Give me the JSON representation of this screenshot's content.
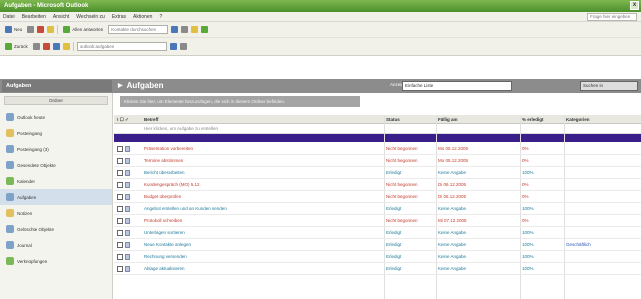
{
  "window": {
    "title": "Aufgaben - Microsoft Outlook",
    "close": "x"
  },
  "menu": [
    "Datei",
    "Bearbeiten",
    "Ansicht",
    "Wechseln zu",
    "Extras",
    "Aktionen",
    "?"
  ],
  "help_placeholder": "Frage hier eingeben",
  "toolbar1": {
    "new": "Neu",
    "reply_all": "Allen antworten",
    "search_placeholder": "Kontakte durchsuchen",
    "address_book": "Adressbuch"
  },
  "toolbar2": {
    "back": "Zurück",
    "address_value": "outlook:aufgaben"
  },
  "nav": {
    "header": "Aufgaben",
    "section": "Ordner",
    "items": [
      "Outlook heute",
      "Posteingang",
      "Posteingang (3)",
      "Gesendete Objekte",
      "Kalender",
      "Aufgaben",
      "Notizen",
      "Gelöschte Objekte",
      "Journal",
      "Verknüpfungen"
    ],
    "active_index": 5
  },
  "main": {
    "title": "Aufgaben",
    "title_chevron": "▾",
    "filter_label": "Anzeige:",
    "filter_value": "Einfache Liste",
    "search_value": "Suchen in",
    "banner": "Klicken Sie hier, um Elemente hinzuzufügen, die sich in diesem Ordner befinden."
  },
  "table": {
    "columns": [
      "Betreff",
      "Status",
      "Fällig am",
      "% erledigt",
      "Kategorien"
    ],
    "new_task_placeholder": "Hier klicken, um Aufgabe zu erstellen",
    "rows": [
      {
        "subject": "Präsentation vorbereiten",
        "status": "Nicht begonnen",
        "due": "Mo 05.12.2005",
        "pct": "0%",
        "cat": "",
        "color": "red"
      },
      {
        "subject": "Termine abstimmen",
        "status": "Nicht begonnen",
        "due": "Mo 05.12.2005",
        "pct": "0%",
        "cat": "",
        "color": "red"
      },
      {
        "subject": "Bericht überarbeiten",
        "status": "Erledigt",
        "due": "Keine Angabe",
        "pct": "100%",
        "cat": "",
        "color": "teal"
      },
      {
        "subject": "Kundengespräch (MO) 5.12.",
        "status": "Nicht begonnen",
        "due": "Di 06.12.2005",
        "pct": "0%",
        "cat": "",
        "color": "red"
      },
      {
        "subject": "Budget überprüfen",
        "status": "Nicht begonnen",
        "due": "Di 06.12.2005",
        "pct": "0%",
        "cat": "",
        "color": "red"
      },
      {
        "subject": "Angebot erstellen und an Kunden senden",
        "status": "Erledigt",
        "due": "Keine Angabe",
        "pct": "100%",
        "cat": "",
        "color": "teal"
      },
      {
        "subject": "Protokoll schreiben",
        "status": "Nicht begonnen",
        "due": "Mi 07.12.2005",
        "pct": "0%",
        "cat": "",
        "color": "red"
      },
      {
        "subject": "Unterlagen sortieren",
        "status": "Erledigt",
        "due": "Keine Angabe",
        "pct": "100%",
        "cat": "",
        "color": "teal"
      },
      {
        "subject": "Neue Kontakte anlegen",
        "status": "Erledigt",
        "due": "Keine Angabe",
        "pct": "100%",
        "cat": "Geschäftlich",
        "color": "teal"
      },
      {
        "subject": "Rechnung versenden",
        "status": "Erledigt",
        "due": "Keine Angabe",
        "pct": "100%",
        "cat": "",
        "color": "teal"
      },
      {
        "subject": "Ablage aktualisieren",
        "status": "Erledigt",
        "due": "Keine Angabe",
        "pct": "100%",
        "cat": "",
        "color": "teal"
      }
    ]
  },
  "colors": {
    "accent": "#3a1e8a",
    "titlebar": "#5a9a35",
    "overdue": "#c43a2a",
    "done": "#1e7a9a"
  }
}
